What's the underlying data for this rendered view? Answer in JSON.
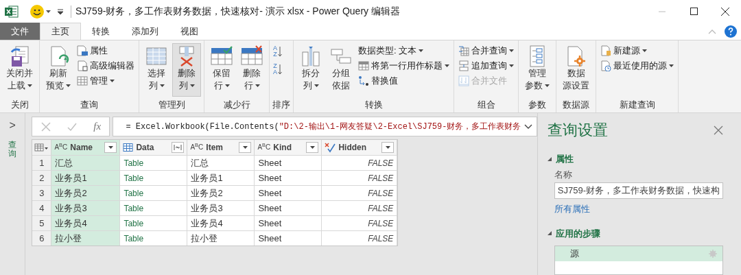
{
  "window": {
    "title": "SJ759-财务，多工作表财务数据，快速核对- 演示 xlsx - Power Query 编辑器"
  },
  "tabs": [
    {
      "label": "文件",
      "kind": "file",
      "selected": false
    },
    {
      "label": "主页",
      "kind": "tab",
      "selected": true
    },
    {
      "label": "转换",
      "kind": "tab",
      "selected": false
    },
    {
      "label": "添加列",
      "kind": "tab",
      "selected": false
    },
    {
      "label": "视图",
      "kind": "tab",
      "selected": false
    }
  ],
  "ribbon": [
    {
      "label": "关闭",
      "items": [
        {
          "kind": "large",
          "lines": [
            "关闭并",
            "上载"
          ],
          "dropdown": true,
          "highlighted": false
        }
      ]
    },
    {
      "label": "查询",
      "items": [
        {
          "kind": "large",
          "lines": [
            "刷新",
            "预览"
          ],
          "dropdown": true,
          "highlighted": false
        },
        {
          "kind": "small",
          "label": "属性",
          "dropdown": false,
          "disabled": false
        },
        {
          "kind": "small",
          "label": "高级编辑器",
          "dropdown": false,
          "disabled": false
        },
        {
          "kind": "small",
          "label": "管理",
          "dropdown": true,
          "disabled": false
        }
      ]
    },
    {
      "label": "管理列",
      "items": [
        {
          "kind": "large",
          "lines": [
            "选择",
            "列"
          ],
          "dropdown": true,
          "highlighted": false
        },
        {
          "kind": "large",
          "lines": [
            "删除",
            "列"
          ],
          "dropdown": true,
          "highlighted": true
        }
      ]
    },
    {
      "label": "减少行",
      "items": [
        {
          "kind": "large",
          "lines": [
            "保留",
            "行"
          ],
          "dropdown": true,
          "highlighted": false
        },
        {
          "kind": "large",
          "lines": [
            "删除",
            "行"
          ],
          "dropdown": true,
          "highlighted": false
        }
      ]
    },
    {
      "label": "排序",
      "items": [
        {
          "kind": "sort",
          "glyphs": [
            "A",
            "Z"
          ]
        },
        {
          "kind": "sort",
          "glyphs": [
            "Z",
            "A"
          ]
        }
      ]
    },
    {
      "label": "转换",
      "items": [
        {
          "kind": "large",
          "lines": [
            "拆分",
            "列"
          ],
          "dropdown": true,
          "highlighted": false
        },
        {
          "kind": "large",
          "lines": [
            "分组",
            "依据"
          ],
          "dropdown": false,
          "highlighted": false
        },
        {
          "kind": "small",
          "label": "数据类型: 文本",
          "dropdown": true,
          "disabled": false
        },
        {
          "kind": "small",
          "label": "将第一行用作标题",
          "dropdown": true,
          "disabled": false
        },
        {
          "kind": "small",
          "label": "替换值",
          "dropdown": false,
          "disabled": false
        }
      ]
    },
    {
      "label": "组合",
      "items": [
        {
          "kind": "small",
          "label": "合并查询",
          "dropdown": true,
          "disabled": false
        },
        {
          "kind": "small",
          "label": "追加查询",
          "dropdown": true,
          "disabled": false
        },
        {
          "kind": "small",
          "label": "合并文件",
          "dropdown": false,
          "disabled": true
        }
      ]
    },
    {
      "label": "参数",
      "items": [
        {
          "kind": "large",
          "lines": [
            "管理",
            "参数"
          ],
          "dropdown": true,
          "highlighted": false
        }
      ]
    },
    {
      "label": "数据源",
      "items": [
        {
          "kind": "large",
          "lines": [
            "数据",
            "源设置"
          ],
          "dropdown": false,
          "highlighted": false
        }
      ]
    },
    {
      "label": "新建查询",
      "items": [
        {
          "kind": "small",
          "label": "新建源",
          "dropdown": true,
          "disabled": false
        },
        {
          "kind": "small",
          "label": "最近使用的源",
          "dropdown": true,
          "disabled": false
        }
      ]
    }
  ],
  "queries_pane": {
    "label": "查询",
    "expand": ">"
  },
  "formula_bar": {
    "fx": "fx",
    "formula": "= Excel.Workbook(File.Contents(\"D:\\2-输出\\1-网友答疑\\2-Excel\\SJ759-财务，多工作表财务"
  },
  "table": {
    "columns": [
      {
        "name": "Name",
        "kind": "text",
        "badge": "A$^{B}$C",
        "selected": true
      },
      {
        "name": "Data",
        "kind": "table",
        "selected": false
      },
      {
        "name": "Item",
        "kind": "text",
        "badge": "A$^{B}$C",
        "selected": false
      },
      {
        "name": "Kind",
        "kind": "text",
        "badge": "A$^{B}$C",
        "selected": false
      },
      {
        "name": "Hidden",
        "kind": "logical",
        "selected": false
      }
    ],
    "rows": [
      {
        "number": "1",
        "cells": [
          "汇总",
          "Table",
          "汇总",
          "Sheet",
          "FALSE"
        ]
      },
      {
        "number": "2",
        "cells": [
          "业务员1",
          "Table",
          "业务员1",
          "Sheet",
          "FALSE"
        ]
      },
      {
        "number": "3",
        "cells": [
          "业务员2",
          "Table",
          "业务员2",
          "Sheet",
          "FALSE"
        ]
      },
      {
        "number": "4",
        "cells": [
          "业务员3",
          "Table",
          "业务员3",
          "Sheet",
          "FALSE"
        ]
      },
      {
        "number": "5",
        "cells": [
          "业务员4",
          "Table",
          "业务员4",
          "Sheet",
          "FALSE"
        ]
      },
      {
        "number": "6",
        "cells": [
          "拉小登",
          "Table",
          "拉小登",
          "Sheet",
          "FALSE"
        ]
      }
    ]
  },
  "settings": {
    "title": "查询设置",
    "properties": {
      "heading": "属性",
      "expanded": true,
      "name_label": "名称",
      "name_value": "SJ759-财务，多工作表财务数据，快速构",
      "link": "所有属性"
    },
    "steps": {
      "heading": "应用的步骤",
      "expanded": true,
      "items": [
        {
          "label": "源",
          "selected": true
        }
      ]
    }
  }
}
